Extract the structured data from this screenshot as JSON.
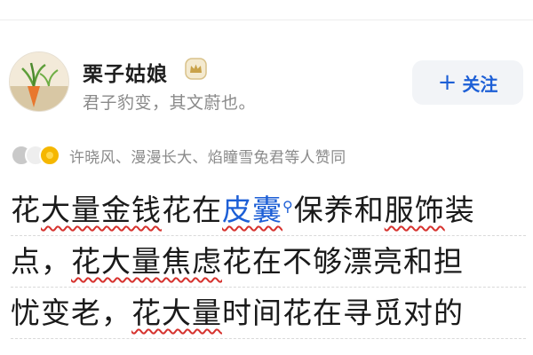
{
  "author": {
    "name": "栗子姑娘",
    "bio": "君子豹变，其文蔚也。",
    "avatar_icon": "carrot-plant-illustration",
    "badge_icon": "crown-badge-icon"
  },
  "follow": {
    "plus": "+",
    "label": "关注"
  },
  "likers": {
    "text": "许晓风、漫漫长大、焰瞳雪兔君等人赞同"
  },
  "answer": {
    "line1": {
      "a": "花",
      "b": "大量金钱",
      "c": "花在",
      "d": "皮囊",
      "e": "保养和",
      "f": "服饰",
      "g": "装"
    },
    "line2": {
      "a": "点，",
      "b": "花大量焦虑",
      "c": "花在不够漂亮和担"
    },
    "line3": {
      "a": "忧变老，",
      "b": "花大量",
      "c": "时间花在寻觅对的"
    }
  },
  "colors": {
    "link": "#1d5fd6",
    "highlight_underline": "#d6322e",
    "muted_text": "#8a8a8a",
    "follow_bg": "#f2f4f7"
  }
}
